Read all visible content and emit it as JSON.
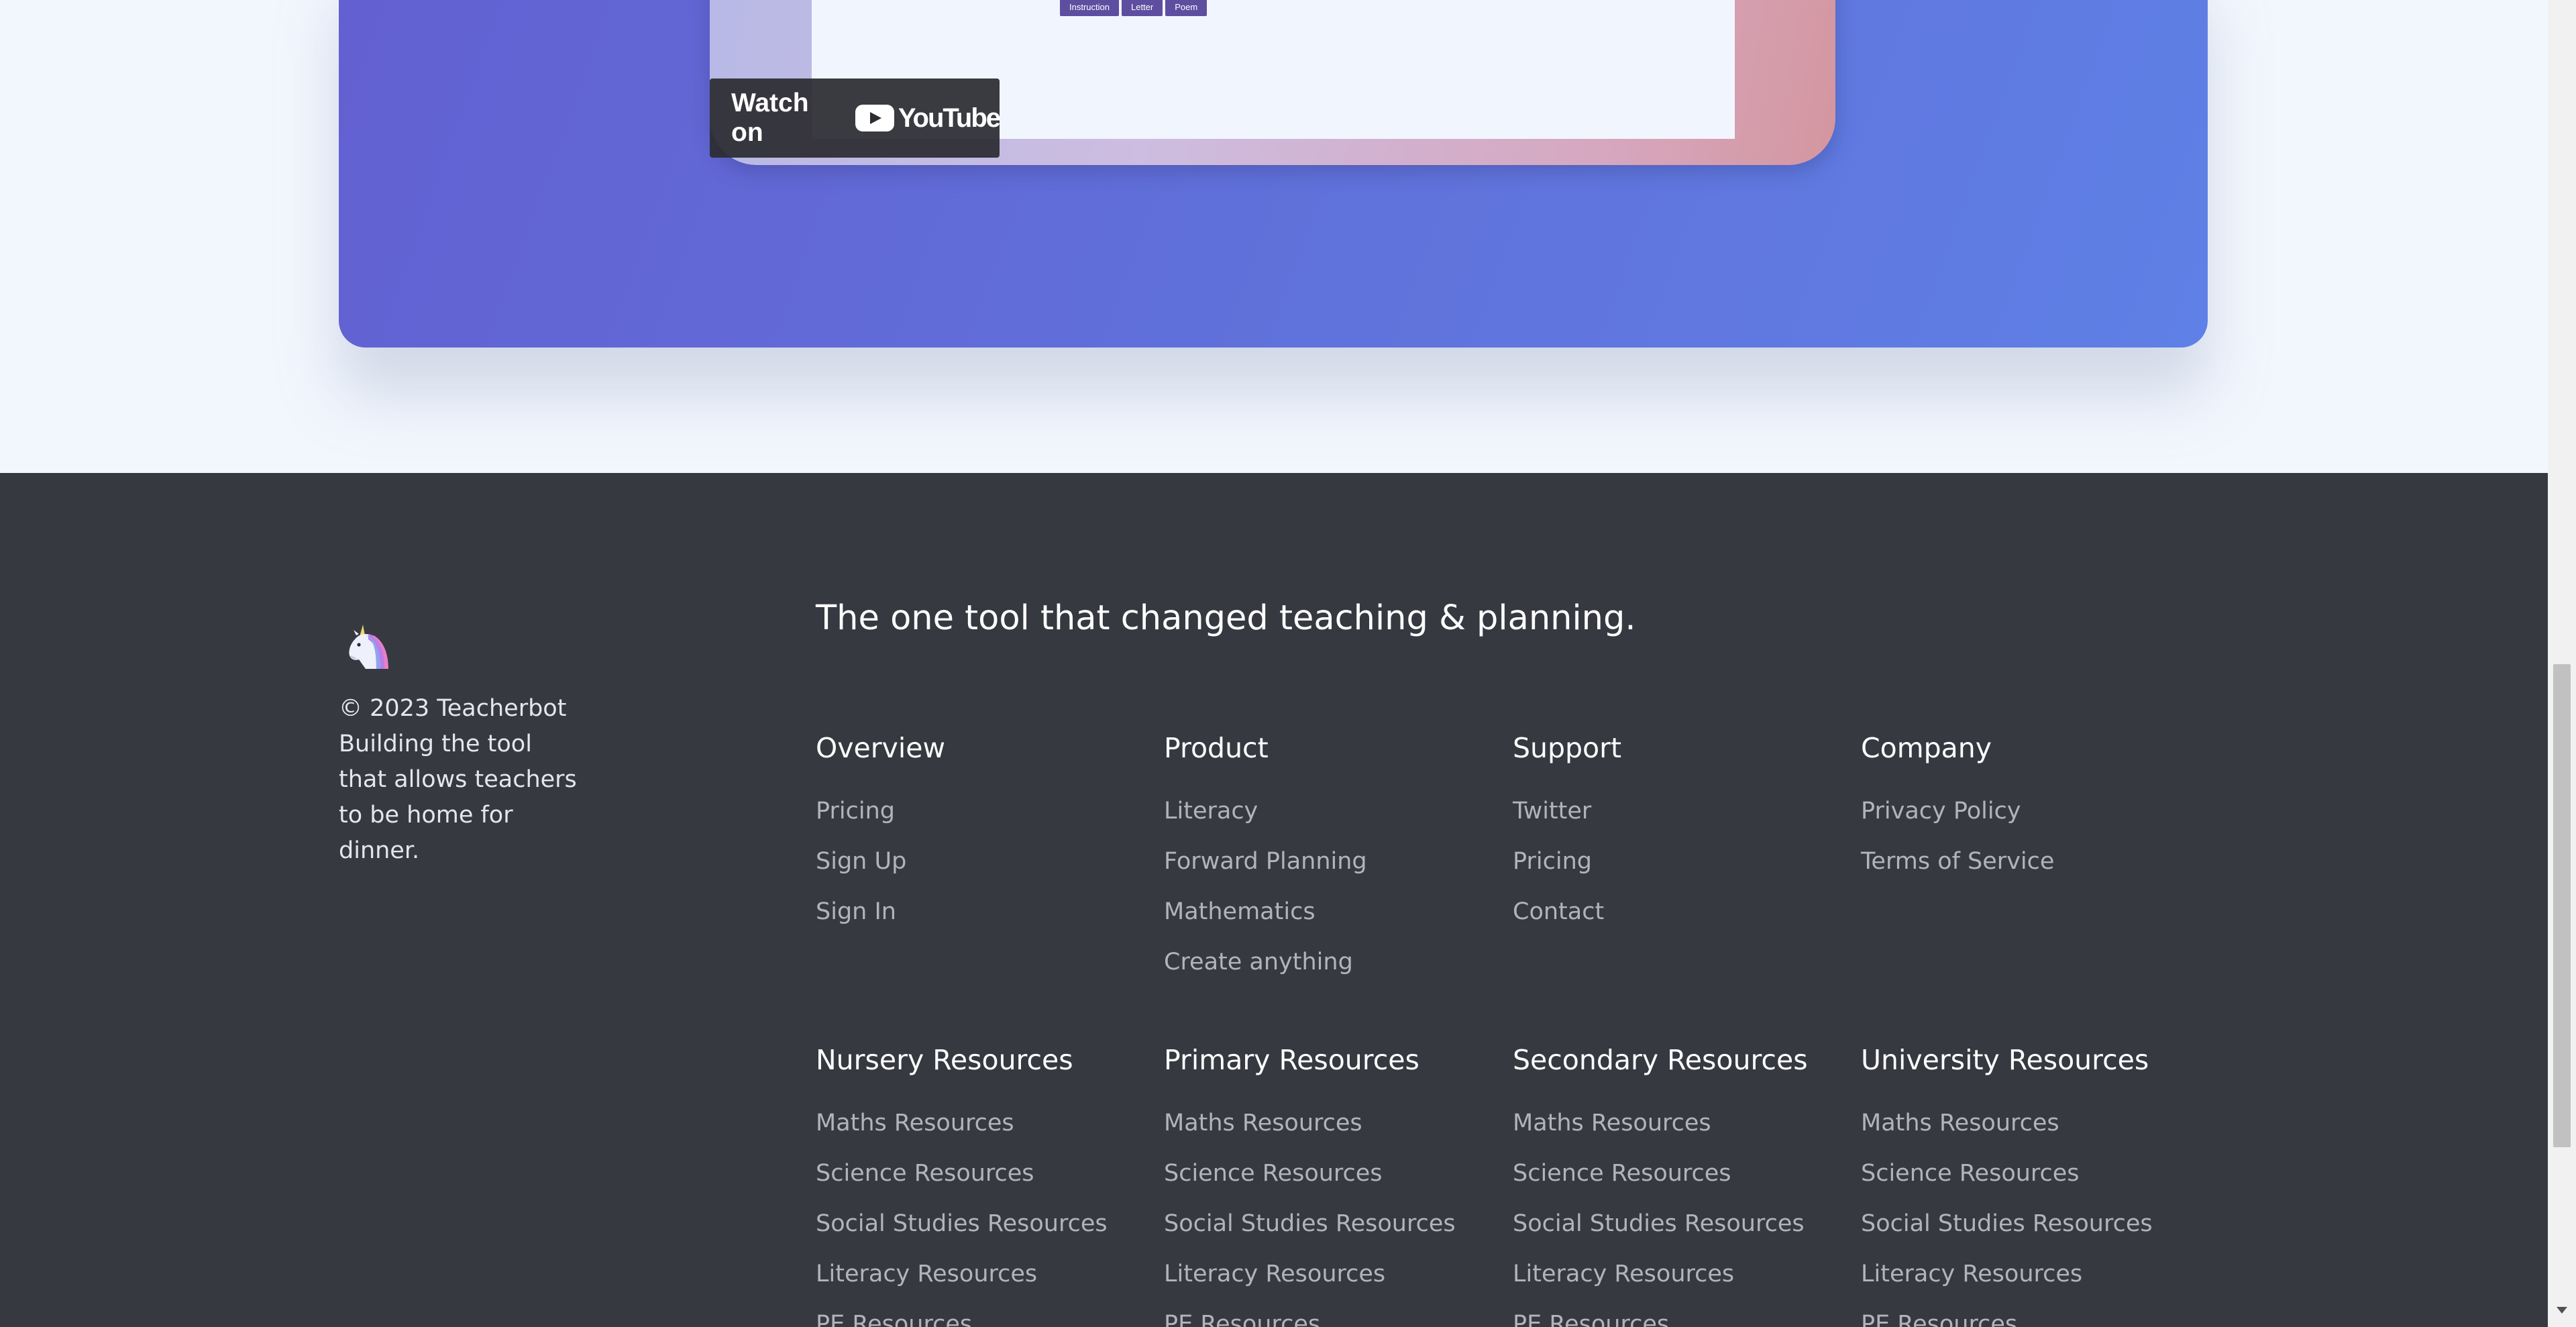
{
  "video": {
    "pills": [
      "Instruction",
      "Letter",
      "Poem"
    ],
    "watch_on_label": "Watch on",
    "youtube_label": "YouTube"
  },
  "footer": {
    "brand": {
      "logo_icon": "unicorn-icon",
      "copyright": "© 2023 Teacherbot",
      "description": "Building the tool that allows teachers to be home for dinner."
    },
    "tagline": "The one tool that changed teaching & planning.",
    "columns": [
      {
        "title": "Overview",
        "links": [
          "Pricing",
          "Sign Up",
          "Sign In"
        ]
      },
      {
        "title": "Product",
        "links": [
          "Literacy",
          "Forward Planning",
          "Mathematics",
          "Create anything"
        ]
      },
      {
        "title": "Support",
        "links": [
          "Twitter",
          "Pricing",
          "Contact"
        ]
      },
      {
        "title": "Company",
        "links": [
          "Privacy Policy",
          "Terms of Service"
        ]
      },
      {
        "title": "Nursery Resources",
        "links": [
          "Maths Resources",
          "Science Resources",
          "Social Studies Resources",
          "Literacy Resources",
          "PE Resources"
        ]
      },
      {
        "title": "Primary Resources",
        "links": [
          "Maths Resources",
          "Science Resources",
          "Social Studies Resources",
          "Literacy Resources",
          "PE Resources"
        ]
      },
      {
        "title": "Secondary Resources",
        "links": [
          "Maths Resources",
          "Science Resources",
          "Social Studies Resources",
          "Literacy Resources",
          "PE Resources"
        ]
      },
      {
        "title": "University Resources",
        "links": [
          "Maths Resources",
          "Science Resources",
          "Social Studies Resources",
          "Literacy Resources",
          "PE Resources"
        ]
      }
    ]
  },
  "colors": {
    "footer_bg": "#363940",
    "hero_gradient_start": "#6360d2",
    "hero_gradient_end": "#5f80e6",
    "link_color": "#b1b4bb",
    "page_bg": "#f2f7fe"
  }
}
